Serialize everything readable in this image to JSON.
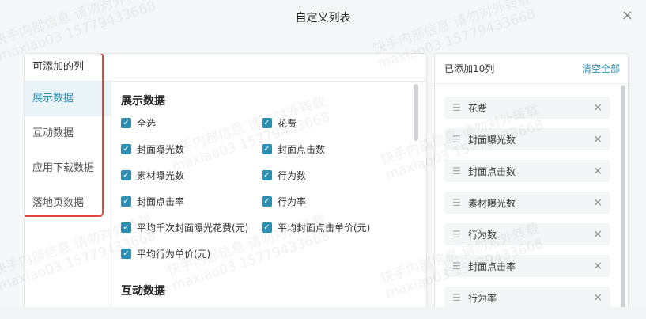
{
  "dialog": {
    "title": "自定义列表",
    "close_label": "×"
  },
  "left": {
    "header": "可添加的列",
    "categories": [
      {
        "label": "展示数据",
        "active": true
      },
      {
        "label": "互动数据"
      },
      {
        "label": "应用下载数据"
      },
      {
        "label": "落地页数据"
      }
    ]
  },
  "content": {
    "section1_title": "展示数据",
    "options": [
      "全选",
      "花费",
      "封面曝光数",
      "封面点击数",
      "素材曝光数",
      "行为数",
      "封面点击率",
      "行为率",
      "平均千次封面曝光花费(元)",
      "平均封面点击单价(元)",
      "平均行为单价(元)"
    ],
    "check_glyph": "✓",
    "section2_title": "互动数据"
  },
  "right": {
    "count_label": "已添加10列",
    "clear_label": "清空全部",
    "drag_glyph": "☰",
    "remove_glyph": "×",
    "items": [
      "花费",
      "封面曝光数",
      "封面点击数",
      "素材曝光数",
      "行为数",
      "封面点击率",
      "行为率"
    ]
  },
  "watermark": {
    "line1": "快手内部信息 请勿对外转载",
    "line2": "maxiao03 15779433668"
  },
  "colors": {
    "accent": "#2b8fb4",
    "highlight": "#e0473d"
  }
}
